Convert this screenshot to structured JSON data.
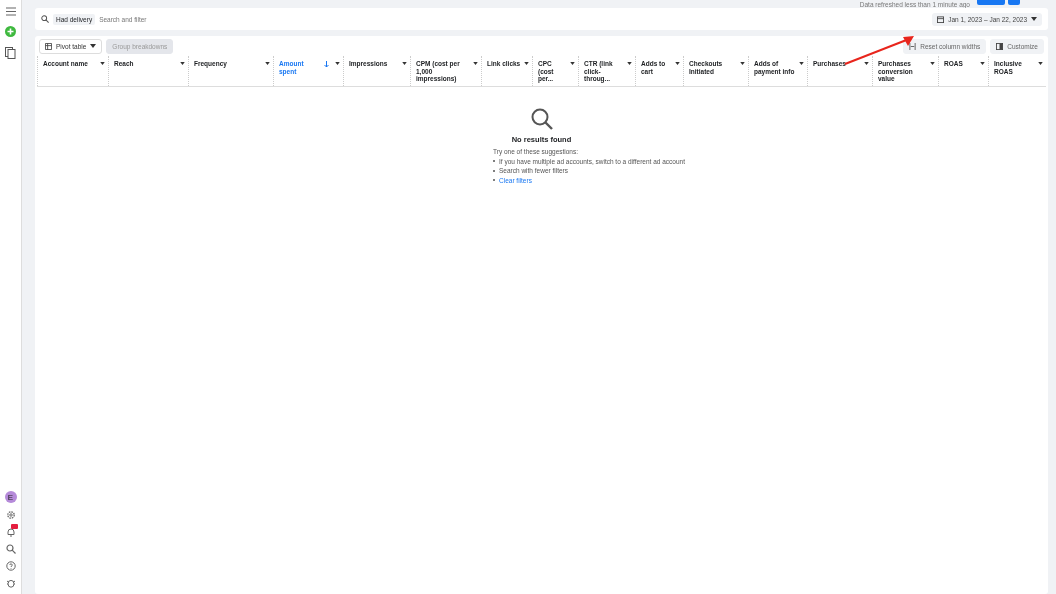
{
  "header": {
    "refresh_note": "Data refreshed less than 1 minute ago"
  },
  "filter_bar": {
    "chip": "Had delivery",
    "placeholder": "Search and filter",
    "date_range": "Jan 1, 2023 – Jan 22, 2023"
  },
  "toolbar": {
    "pivot": "Pivot table",
    "group": {
      "label": "Group breakdowns",
      "disabled": true
    },
    "reset": "Reset column widths",
    "customize": "Customize"
  },
  "columns": [
    {
      "label": "Account name",
      "sorted": false
    },
    {
      "label": "Reach",
      "sorted": false
    },
    {
      "label": "Frequency",
      "sorted": false
    },
    {
      "label": "Amount spent",
      "sorted": true
    },
    {
      "label": "Impressions",
      "sorted": false
    },
    {
      "label": "CPM (cost per 1,000 impressions)",
      "sorted": false
    },
    {
      "label": "Link clicks",
      "sorted": false
    },
    {
      "label": "CPC (cost per...",
      "sorted": false
    },
    {
      "label": "CTR (link click-throug...",
      "sorted": false
    },
    {
      "label": "Adds to cart",
      "sorted": false
    },
    {
      "label": "Checkouts Initiated",
      "sorted": false
    },
    {
      "label": "Adds of payment info",
      "sorted": false
    },
    {
      "label": "Purchases",
      "sorted": false
    },
    {
      "label": "Purchases conversion value",
      "sorted": false
    },
    {
      "label": "ROAS",
      "sorted": false
    },
    {
      "label": "Inclusive ROAS",
      "sorted": false
    }
  ],
  "empty_state": {
    "title": "No results found",
    "intro": "Try one of these suggestions:",
    "suggestions": [
      {
        "text": "If you have multiple ad accounts, switch to a different ad account",
        "kind": "text"
      },
      {
        "text": "Search with fewer filters",
        "kind": "text"
      },
      {
        "text": "Clear filters",
        "kind": "link"
      }
    ]
  },
  "sidebar": {
    "avatar": "E"
  }
}
